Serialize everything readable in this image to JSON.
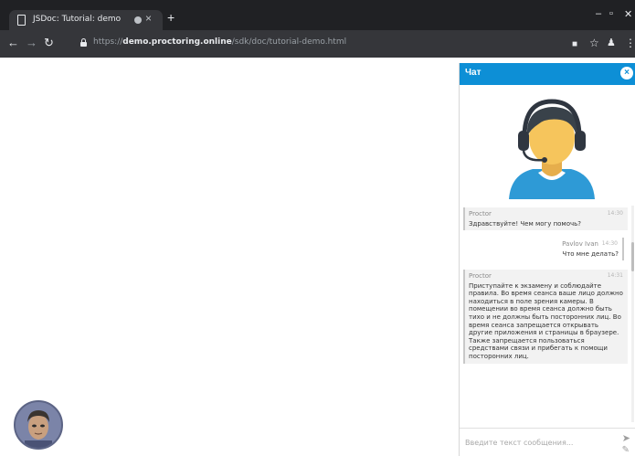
{
  "browser": {
    "tab_title": "JSDoc: Tutorial: demo",
    "tab_close": "×",
    "new_tab": "+",
    "url_scheme": "https://",
    "url_host": "demo.proctoring.online",
    "url_path": "/sdk/doc/tutorial-demo.html",
    "icons": [
      "page-icon",
      "record-icon",
      "back-icon",
      "forward-icon",
      "reload-icon",
      "lock-icon",
      "camera-icon",
      "star-icon",
      "extension-icon",
      "menu-icon"
    ]
  },
  "chat": {
    "title": "Чат",
    "close": "×",
    "accent_color": "#0d8fd6",
    "messages": [
      {
        "direction": "in",
        "author": "Proctor",
        "time": "14:30",
        "text": "Здравствуйте! Чем могу помочь?"
      },
      {
        "direction": "out",
        "author": "Pavlov Ivan",
        "time": "14:30",
        "text": "Что мне делать?"
      },
      {
        "direction": "in",
        "author": "Proctor",
        "time": "14:31",
        "text": "Приступайте к экзамену и соблюдайте правила. Во время сеанса ваше лицо должно находиться в поле зрения камеры. В помещении во время сеанса должно быть тихо и не должны быть посторонних лиц. Во время сеанса запрещается открывать другие приложения и страницы в браузере. Также запрещается пользоваться средствами связи и прибегать к помощи посторонних лиц."
      }
    ],
    "composer_placeholder": "Введите текст сообщения..."
  }
}
